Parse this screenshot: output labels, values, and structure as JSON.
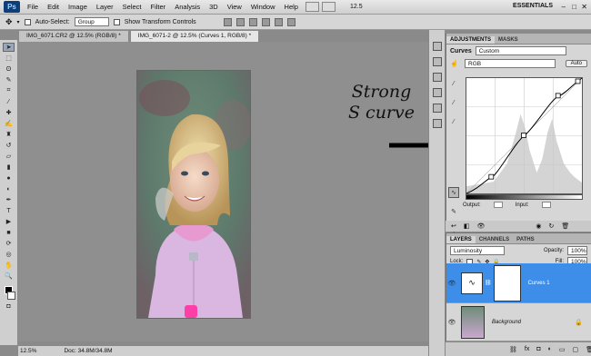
{
  "app": {
    "logo": "Ps",
    "menus": [
      "File",
      "Edit",
      "Image",
      "Layer",
      "Select",
      "Filter",
      "Analysis",
      "3D",
      "View",
      "Window",
      "Help"
    ],
    "zoom": "12.5",
    "workspace": "ESSENTIALS",
    "window_controls": [
      "–",
      "□",
      "✕"
    ]
  },
  "options_bar": {
    "auto_select_label": "Auto-Select:",
    "auto_select_value": "Group",
    "transform_label": "Show Transform Controls"
  },
  "tabs": [
    {
      "label": "IMG_6071.CR2 @ 12.5% (RGB/8) *",
      "active": false
    },
    {
      "label": "IMG_6071-2 @ 12.5% (Curves 1, RGB/8) *",
      "active": true
    }
  ],
  "annotation": {
    "line1": "Strong",
    "line2": "S curve"
  },
  "status_bar": {
    "zoom": "12.5%",
    "doc": "Doc: 34.8M/34.8M"
  },
  "adjustments": {
    "tabs": [
      "ADJUSTMENTS",
      "MASKS"
    ],
    "panel_title": "Curves",
    "preset": "Custom",
    "channel": "RGB",
    "auto_label": "Auto",
    "output_label": "Output:",
    "input_label": "Input:"
  },
  "layers": {
    "tabs": [
      "LAYERS",
      "CHANNELS",
      "PATHS"
    ],
    "blend_mode": "Luminosity",
    "opacity_label": "Opacity:",
    "opacity_value": "100%",
    "lock_label": "Lock:",
    "fill_label": "Fill:",
    "fill_value": "100%",
    "items": [
      {
        "name": "Curves 1",
        "selected": true
      },
      {
        "name": "Background",
        "selected": false
      }
    ]
  },
  "colors": {
    "accent": "#3d8ee8",
    "chrome": "#d6d6d6",
    "canvas": "#8f8f8f"
  }
}
